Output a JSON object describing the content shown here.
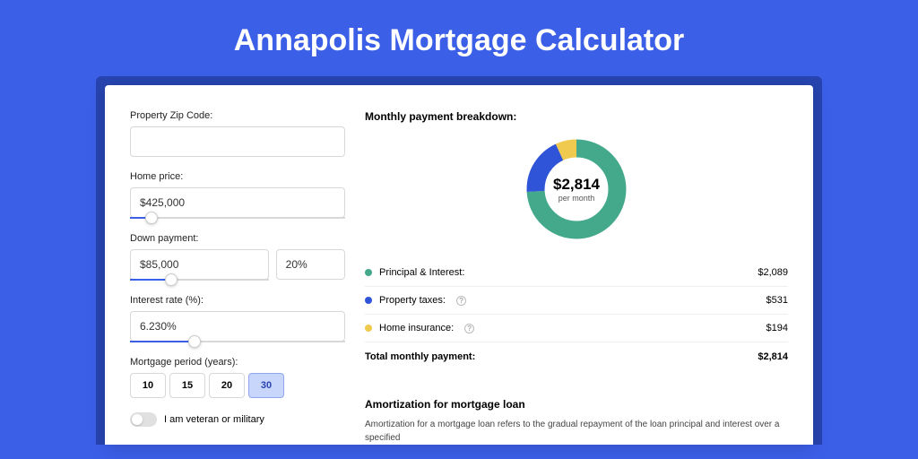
{
  "page": {
    "title": "Annapolis Mortgage Calculator"
  },
  "form": {
    "zip": {
      "label": "Property Zip Code:",
      "value": ""
    },
    "home_price": {
      "label": "Home price:",
      "value": "$425,000",
      "slider_pct": 10
    },
    "down_payment": {
      "label": "Down payment:",
      "amount": "$85,000",
      "pct": "20%",
      "slider_pct": 20
    },
    "interest": {
      "label": "Interest rate (%):",
      "value": "6.230%",
      "slider_pct": 30
    },
    "period": {
      "label": "Mortgage period (years):",
      "options": [
        "10",
        "15",
        "20",
        "30"
      ],
      "active_index": 3
    },
    "veteran": {
      "label": "I am veteran or military"
    }
  },
  "breakdown": {
    "title": "Monthly payment breakdown:",
    "center_amount": "$2,814",
    "center_sub": "per month",
    "items": [
      {
        "label": "Principal & Interest:",
        "amount": "$2,089",
        "color": "#44a98a",
        "help": false
      },
      {
        "label": "Property taxes:",
        "amount": "$531",
        "color": "#2f54d8",
        "help": true
      },
      {
        "label": "Home insurance:",
        "amount": "$194",
        "color": "#f0c94f",
        "help": true
      }
    ],
    "total_label": "Total monthly payment:",
    "total_amount": "$2,814"
  },
  "amortization": {
    "title": "Amortization for mortgage loan",
    "body": "Amortization for a mortgage loan refers to the gradual repayment of the loan principal and interest over a specified"
  },
  "chart_data": {
    "type": "pie",
    "title": "Monthly payment breakdown",
    "series": [
      {
        "name": "Principal & Interest",
        "value": 2089,
        "color": "#44a98a"
      },
      {
        "name": "Property taxes",
        "value": 531,
        "color": "#2f54d8"
      },
      {
        "name": "Home insurance",
        "value": 194,
        "color": "#f0c94f"
      }
    ],
    "total": 2814
  }
}
